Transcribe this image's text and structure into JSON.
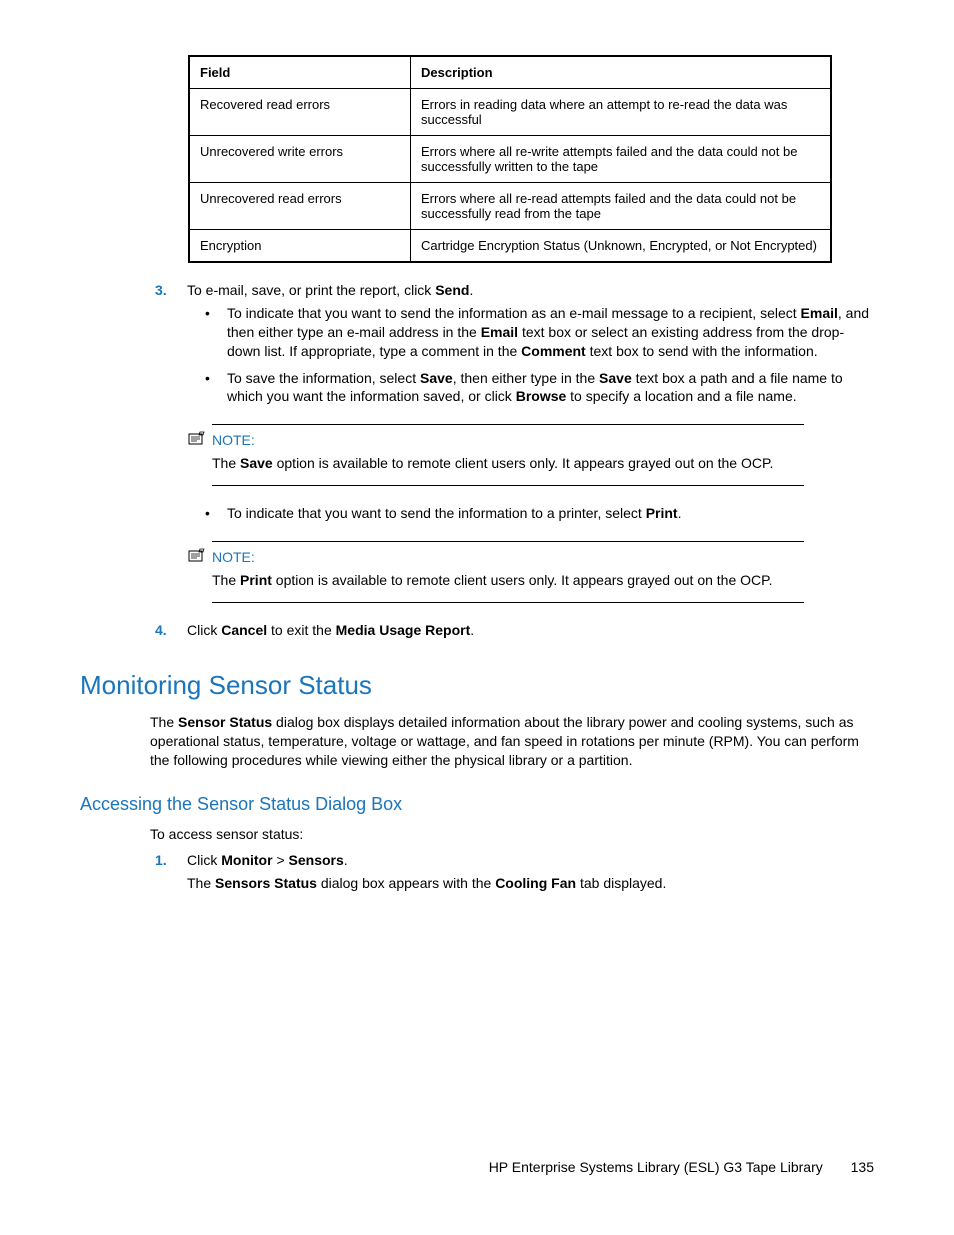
{
  "table": {
    "headers": [
      "Field",
      "Description"
    ],
    "rows": [
      [
        "Recovered read errors",
        "Errors in reading data where an attempt to re-read the data was successful"
      ],
      [
        "Unrecovered write errors",
        "Errors where all re-write attempts failed and the data could not be successfully written to the tape"
      ],
      [
        "Unrecovered read errors",
        "Errors where all re-read attempts failed and the data could not be successfully read from the tape"
      ],
      [
        "Encryption",
        "Cartridge Encryption Status (Unknown, Encrypted, or Not Encrypted)"
      ]
    ]
  },
  "step3": {
    "num": "3.",
    "pre": "To e-mail, save, or print the report, click ",
    "b1": "Send",
    "post": "."
  },
  "bul1": {
    "a": "To indicate that you want to send the information as an e-mail message to a recipient, select ",
    "b1": "Email",
    "b": ", and then either type an e-mail address in the ",
    "b2": "Email",
    "c": " text box or select an existing address from the drop-down list. If appropriate, type a comment in the ",
    "b3": "Comment",
    "d": " text box to send with the information."
  },
  "bul2": {
    "a": "To save the information, select ",
    "b1": "Save",
    "b": ", then either type in the ",
    "b2": "Save",
    "c": " text box a path and a file name to which you want the information saved, or click ",
    "b3": "Browse",
    "d": " to specify a location and a file name."
  },
  "note1": {
    "label": "NOTE:",
    "a": "The ",
    "b1": "Save",
    "b": " option is available to remote client users only. It appears grayed out on the OCP."
  },
  "bul3": {
    "a": "To indicate that you want to send the information to a printer, select ",
    "b1": "Print",
    "b": "."
  },
  "note2": {
    "label": "NOTE:",
    "a": "The ",
    "b1": "Print",
    "b": " option is available to remote client users only. It appears grayed out on the OCP."
  },
  "step4": {
    "num": "4.",
    "a": "Click ",
    "b1": "Cancel",
    "b": " to exit the ",
    "b2": "Media Usage Report",
    "c": "."
  },
  "h1": "Monitoring Sensor Status",
  "para1": {
    "a": "The ",
    "b1": "Sensor Status",
    "b": " dialog box displays detailed information about the library power and cooling systems, such as operational status, temperature, voltage or wattage, and fan speed in rotations per minute (RPM). You can perform the following procedures while viewing either the physical library or a partition."
  },
  "h2": "Accessing the Sensor Status Dialog Box",
  "para2": "To access sensor status:",
  "step1b": {
    "num": "1.",
    "a": "Click ",
    "b1": "Monitor",
    "b": " > ",
    "b2": "Sensors",
    "c": "."
  },
  "para3": {
    "a": "The ",
    "b1": "Sensors Status",
    "b": " dialog box appears with the ",
    "b2": "Cooling Fan",
    "c": " tab displayed."
  },
  "footer": {
    "title": "HP Enterprise Systems Library (ESL) G3 Tape Library",
    "page": "135"
  }
}
